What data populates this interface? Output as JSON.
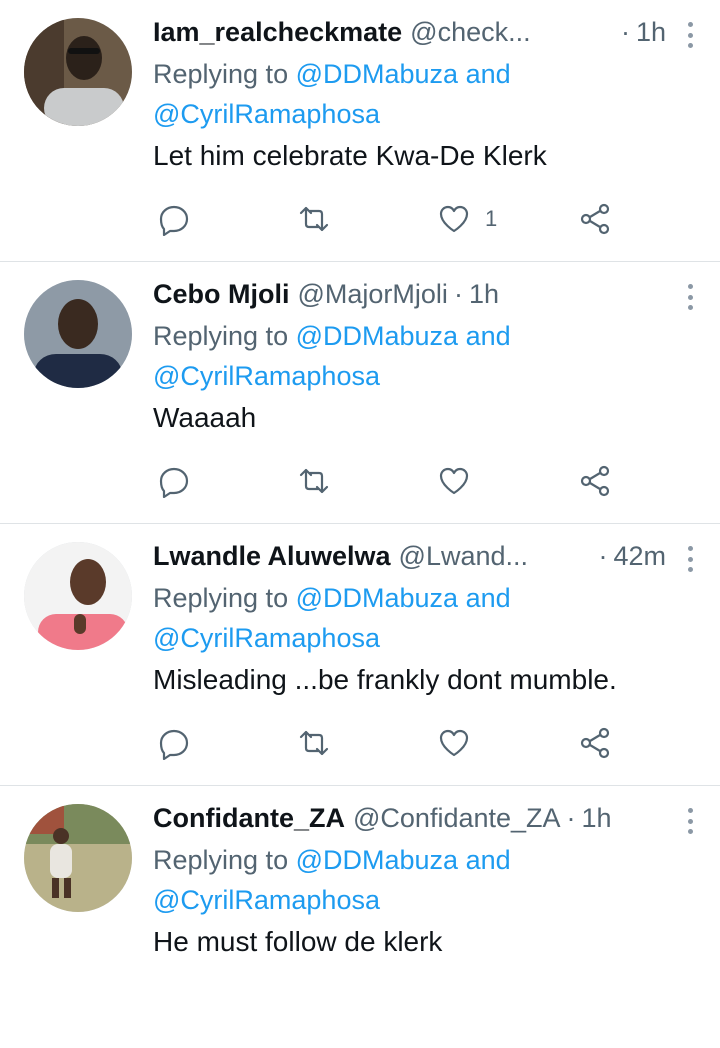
{
  "tweets": [
    {
      "name": "Iam_realcheckmate",
      "handle": "@check...",
      "time": "1h",
      "replying_prefix": "Replying to ",
      "mention1": "@DDMabuza",
      "and_word": " and",
      "mention2": "@CyrilRamaphosa",
      "text": "Let him celebrate Kwa-De Klerk",
      "like_count": "1",
      "avatar": {
        "bg": "#6b5a47",
        "skin": "#2b211a",
        "shirt": "#c9cbcc"
      }
    },
    {
      "name": "Cebo Mjoli",
      "handle": "@MajorMjoli",
      "time": "1h",
      "replying_prefix": "Replying to ",
      "mention1": "@DDMabuza",
      "and_word": " and",
      "mention2": "@CyrilRamaphosa",
      "text": "Waaaah",
      "like_count": "",
      "avatar": {
        "bg": "#8e9aa6",
        "skin": "#3a2a20",
        "shirt": "#1f2b44"
      }
    },
    {
      "name": "Lwandle Aluwelwa",
      "handle": "@Lwand...",
      "time": "42m",
      "replying_prefix": "Replying to ",
      "mention1": "@DDMabuza",
      "and_word": " and",
      "mention2": "@CyrilRamaphosa",
      "text": "Misleading ...be frankly dont mumble.",
      "like_count": "",
      "avatar": {
        "bg": "#f3f3f3",
        "skin": "#5a3a2a",
        "shirt": "#f07a8a"
      }
    },
    {
      "name": "Confidante_ZA",
      "handle": "@Confidante_ZA",
      "time": "1h",
      "replying_prefix": "Replying to ",
      "mention1": "@DDMabuza",
      "and_word": " and",
      "mention2": "@CyrilRamaphosa",
      "text": "He must follow de klerk",
      "like_count": "",
      "avatar": {
        "bg": "#b9b28a",
        "skin": "#4a3226",
        "shirt": "#e9e6e0"
      }
    }
  ],
  "separator": "·",
  "icons": {
    "reply": "reply-icon",
    "retweet": "retweet-icon",
    "like": "like-icon",
    "share": "share-icon",
    "more": "more-options-icon"
  },
  "colors": {
    "mention": "#1d9bf0",
    "secondary_text": "#536471",
    "primary_text": "#0f1419"
  }
}
